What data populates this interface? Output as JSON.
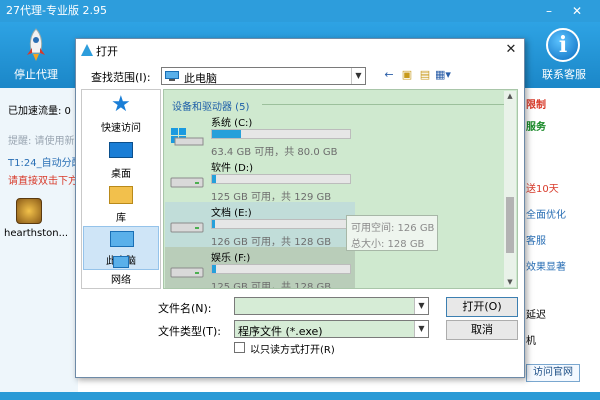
{
  "app": {
    "title": "27代理-专业版 2.95",
    "toolbar": {
      "stop_proxy_label": "停止代理",
      "contact_support_label": "联系客服"
    },
    "left_panel": {
      "accelerated_label": "已加速流量: 0",
      "tip_text": "提醒: 请使用新",
      "status_text": "T1:24_自动分配",
      "hint_text": "请直接双击下方",
      "game_label": "hearthston..."
    },
    "right_panel": {
      "links": [
        "限制",
        "服务",
        "送10天",
        "全面优化",
        "客服",
        "效果显著",
        "延迟",
        "机"
      ],
      "visit_site_label": "访问官网"
    }
  },
  "dialog": {
    "title": "打开",
    "look_in_label": "查找范围(I):",
    "look_in_value": "此电脑",
    "places": [
      {
        "label": "快速访问",
        "icon": "star-icon"
      },
      {
        "label": "桌面",
        "icon": "desktop-icon"
      },
      {
        "label": "库",
        "icon": "library-icon"
      },
      {
        "label": "此电脑",
        "icon": "computer-icon"
      },
      {
        "label": "网络",
        "icon": "network-icon"
      }
    ],
    "group_header": "设备和驱动器 (5)",
    "drives": [
      {
        "name": "系统 (C:)",
        "info": "63.4 GB 可用，共 80.0 GB",
        "used_fraction": 0.21
      },
      {
        "name": "软件 (D:)",
        "info": "125 GB 可用，共 129 GB",
        "used_fraction": 0.03
      },
      {
        "name": "文档 (E:)",
        "info": "126 GB 可用，共 128 GB",
        "used_fraction": 0.02
      },
      {
        "name": "娱乐 (F:)",
        "info": "125 GB 可用，共 128 GB",
        "used_fraction": 0.03
      }
    ],
    "tooltip": {
      "free_space": "可用空间: 126 GB",
      "total_size": "总大小: 128 GB"
    },
    "filename_label": "文件名(N):",
    "filename_value": "",
    "filetype_label": "文件类型(T):",
    "filetype_value": "程序文件 (*.exe)",
    "readonly_label": "以只读方式打开(R)",
    "open_button": "打开(O)",
    "cancel_button": "取消"
  },
  "colors": {
    "accent": "#2d9ddc",
    "drive_fill": "#26a0da",
    "list_bg": "#cfe9cf",
    "warning_red": "#d83a2a",
    "link_green": "#1a8a2a"
  }
}
